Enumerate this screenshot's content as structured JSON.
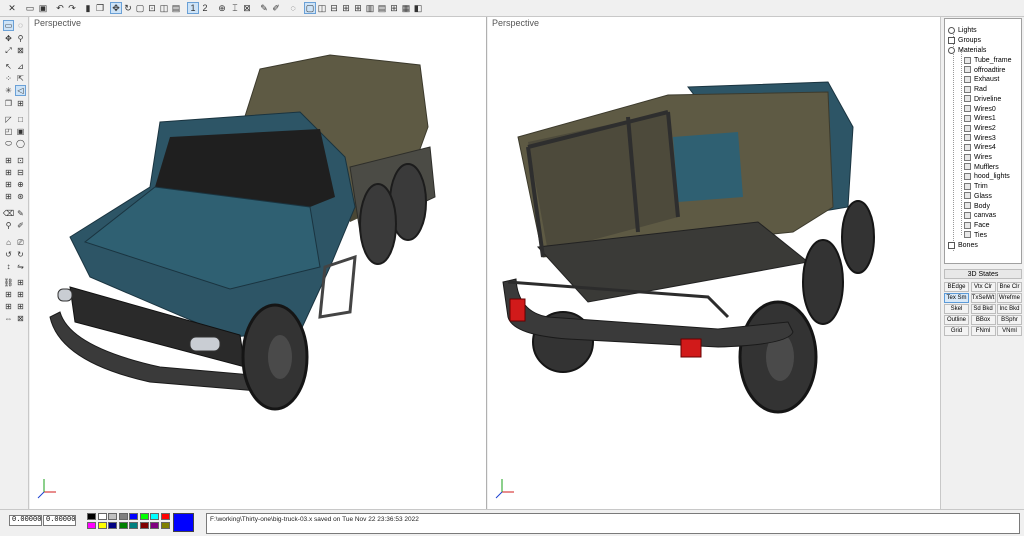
{
  "viewports": {
    "left": {
      "label": "Perspective"
    },
    "right": {
      "label": "Perspective"
    }
  },
  "toolbar": {
    "view_one": "1",
    "view_two": "2"
  },
  "tree": {
    "lights": "Lights",
    "groups": "Groups",
    "materials": "Materials",
    "bones": "Bones",
    "material_items": [
      "Tube_frame",
      "offroadtire",
      "Exhaust",
      "Rad",
      "Driveline",
      "Wires0",
      "Wires1",
      "Wires2",
      "Wires3",
      "Wires4",
      "Wires",
      "Mufflers",
      "hood_lights",
      "Trim",
      "Glass",
      "Body",
      "canvas",
      "Face",
      "Ties"
    ]
  },
  "states": {
    "title": "3D States",
    "buttons": [
      "BEdge",
      "Vtx Clr",
      "Bne Clr",
      "Tex Sm",
      "TxSelWt",
      "Wrefme",
      "Skel",
      "Sd Bkd",
      "Inc Bkd",
      "Outline",
      "BBox",
      "BSphr",
      "Grid",
      "FNml",
      "VNml"
    ]
  },
  "status": {
    "coord_x": "0.00000",
    "coord_y": "0.00000",
    "message": "F:\\working\\Thirty-one\\big-truck-03.x saved on Tue Nov 22 23:36:53 2022"
  },
  "palette": {
    "primary": "#0000ff",
    "swatches": [
      "#000000",
      "#ffffff",
      "#c0c0c0",
      "#808080",
      "#0000ff",
      "#00ff00",
      "#00ffff",
      "#ff0000",
      "#ff00ff",
      "#ffff00",
      "#000080",
      "#008000",
      "#008080",
      "#800000",
      "#800080",
      "#808000"
    ]
  },
  "colors": {
    "body": "#2d5566",
    "canvas": "#5e5a44",
    "tire": "#3a3a3a",
    "frame": "#4a4a4a",
    "light": "#d11a1a"
  }
}
